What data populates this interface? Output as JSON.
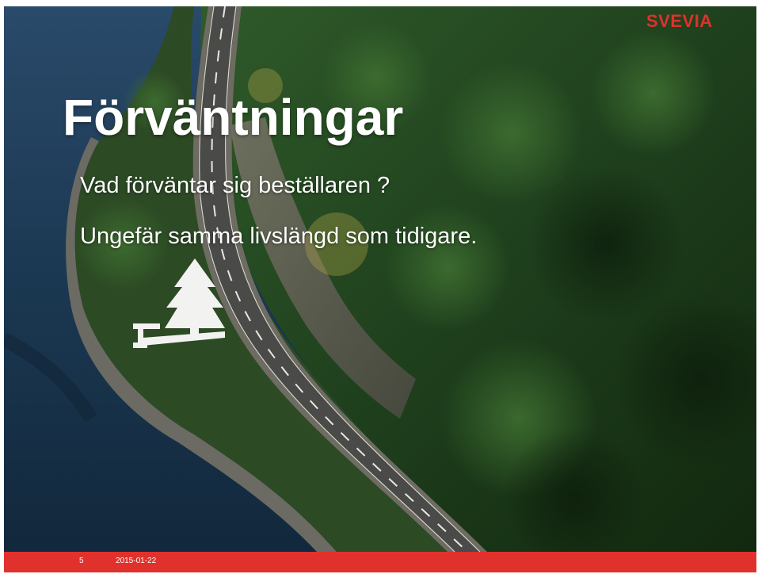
{
  "slide": {
    "logo": "SVEVIA",
    "title": "Förväntningar",
    "bullets": [
      "Vad förväntar sig beställaren ?",
      "Ungefär samma livslängd som tidigare."
    ]
  },
  "footer": {
    "page_number": "5",
    "date": "2015-01-22"
  },
  "colors": {
    "brand_red": "#e0312c",
    "water": "#1b3852",
    "forest": "#1e3d1c",
    "road": "#4a4a48"
  },
  "icons": {
    "tree_icon": "tree-on-ground-icon"
  }
}
